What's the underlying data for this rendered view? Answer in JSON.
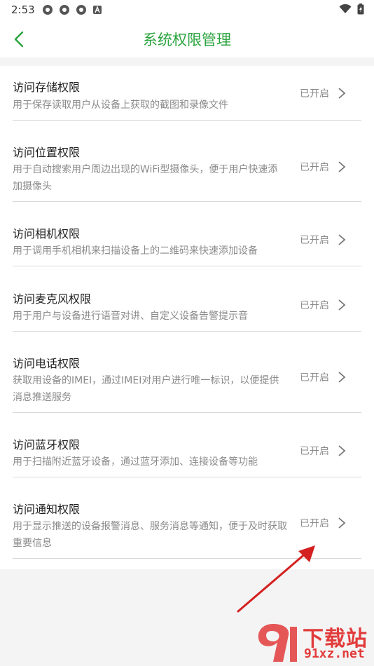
{
  "status_bar": {
    "time": "2:53"
  },
  "header": {
    "title": "系统权限管理"
  },
  "permissions": [
    {
      "title": "访问存储权限",
      "description": "用于保存读取用户从设备上获取的截图和录像文件",
      "status": "已开启"
    },
    {
      "title": "访问位置权限",
      "description": "用于自动搜索用户周边出现的WiFi型摄像头，便于用户快速添加摄像头",
      "status": "已开启"
    },
    {
      "title": "访问相机权限",
      "description": "用于调用手机相机来扫描设备上的二维码来快速添加设备",
      "status": "已开启"
    },
    {
      "title": "访问麦克风权限",
      "description": "用于用户与设备进行语音对讲、自定义设备告警提示音",
      "status": "已开启"
    },
    {
      "title": "访问电话权限",
      "description": "获取用设备的IMEI，通过IMEI对用户进行唯一标识，以便提供消息推送服务",
      "status": "已开启"
    },
    {
      "title": "访问蓝牙权限",
      "description": "用于扫描附近蓝牙设备，通过蓝牙添加、连接设备等功能",
      "status": "已开启"
    },
    {
      "title": "访问通知权限",
      "description": "用于显示推送的设备报警消息、服务消息等通知，便于及时获取重要信息",
      "status": "已开启"
    }
  ],
  "watermark": {
    "brand": "下载站",
    "domain": "91xz.net"
  },
  "colors": {
    "accent": "#29a33d",
    "annotation": "#d42020"
  }
}
